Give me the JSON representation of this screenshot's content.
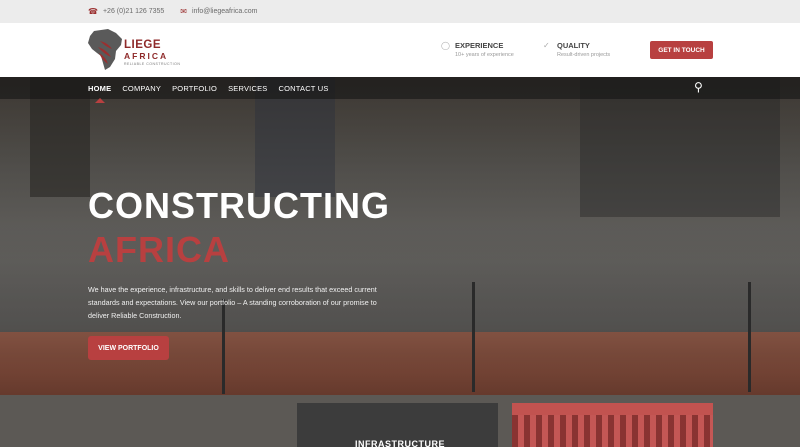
{
  "topbar": {
    "phone_icon": "phone-icon",
    "phone": "+26 (0)21 126 7355",
    "email_icon": "mail-icon",
    "email": "info@liegeafrica.com"
  },
  "header": {
    "logo_line1": "LIEGE",
    "logo_line2": "AFRICA",
    "logo_tagline": "RELIABLE CONSTRUCTION",
    "features": [
      {
        "icon": "medal-icon",
        "title": "EXPERIENCE",
        "subtitle": "10+ years of experience"
      },
      {
        "icon": "check-icon",
        "title": "QUALITY",
        "subtitle": "Result-driven projects"
      }
    ],
    "cta_label": "GET IN TOUCH"
  },
  "nav": {
    "items": [
      "HOME",
      "COMPANY",
      "PORTFOLIO",
      "SERVICES",
      "CONTACT US"
    ],
    "active": "HOME",
    "search_icon": "search-icon"
  },
  "hero": {
    "title_line1": "CONSTRUCTING",
    "title_line2": "AFRICA",
    "description": "We have the experience, infrastructure, and skills to deliver end results that exceed current standards and expectations. View our portfolio – A standing corroboration of our promise to deliver Reliable Construction.",
    "cta_label": "VIEW PORTFOLIO"
  },
  "cards": [
    {
      "label": "INFRASTRUCTURE"
    },
    {
      "label": ""
    }
  ],
  "colors": {
    "accent": "#b84040",
    "topbar_bg": "#ececec",
    "header_bg": "#ffffff"
  }
}
